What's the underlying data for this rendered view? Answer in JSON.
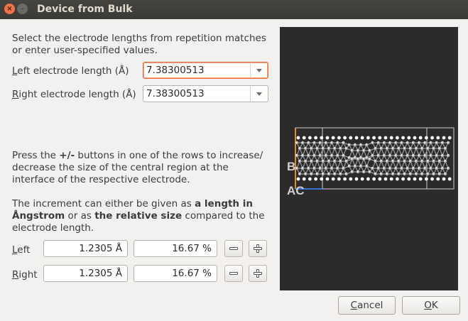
{
  "window": {
    "title": "Device from Bulk",
    "close_glyph": "×",
    "min_glyph": "–"
  },
  "intro": "Select the electrode lengths from repetition matches or enter user-specified values.",
  "left_electrode": {
    "label_ul": "L",
    "label_rest": "eft electrode length (Å)",
    "value": "7.38300513"
  },
  "right_electrode": {
    "label_ul": "R",
    "label_rest": "ight electrode length (Å)",
    "value": "7.38300513"
  },
  "instructions": {
    "part1": "Press the ",
    "bold": "+/-",
    "part2": " buttons in one of the rows to increase/ decrease the size of the central region at the interface of the respective electrode."
  },
  "increment": {
    "part1": "The increment can either be given as ",
    "bold1": "a length in Ångstrom",
    "part2": " or as ",
    "bold2": "the relative size",
    "part3": " compared to the electrode length."
  },
  "rows": {
    "left": {
      "label_ul": "L",
      "label_rest": "eft",
      "length": "1.2305 Å",
      "relative": "16.67 %"
    },
    "right": {
      "label_ul": "R",
      "label_rest": "ight",
      "length": "1.2305 Å",
      "relative": "16.67 %"
    }
  },
  "preview": {
    "label_b": "B",
    "label_ac": "AC",
    "background": "#2b2b2b",
    "accent_orange": "#e8892b",
    "accent_blue": "#3b6fd1"
  },
  "buttons": {
    "cancel_ul": "C",
    "cancel_rest": "ancel",
    "ok_ul": "O",
    "ok_rest": "K"
  }
}
